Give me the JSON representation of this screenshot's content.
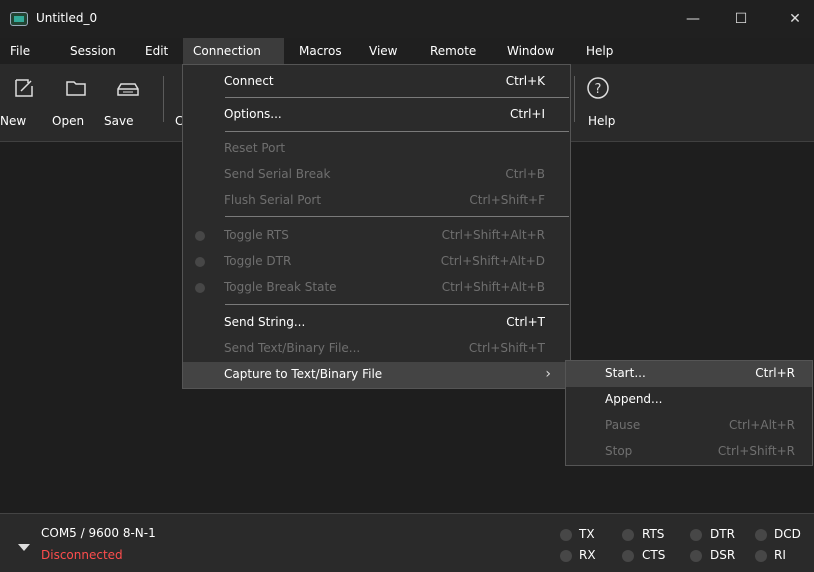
{
  "window": {
    "title": "Untitled_0",
    "minimize_glyph": "—",
    "maximize_glyph": "☐",
    "close_glyph": "✕"
  },
  "menubar": [
    {
      "label": "File",
      "active": false
    },
    {
      "label": "Session",
      "active": false
    },
    {
      "label": "Edit",
      "active": false
    },
    {
      "label": "Connection",
      "active": true
    },
    {
      "label": "Macros",
      "active": false
    },
    {
      "label": "View",
      "active": false
    },
    {
      "label": "Remote",
      "active": false
    },
    {
      "label": "Window",
      "active": false
    },
    {
      "label": "Help",
      "active": false
    }
  ],
  "toolbar": {
    "new": "New",
    "open": "Open",
    "save": "Save",
    "partial": "C",
    "help": "Help",
    "help_glyph": "?"
  },
  "connection_menu": [
    {
      "label": "Connect",
      "shortcut": "Ctrl+K",
      "disabled": false
    },
    {
      "label": "Options...",
      "shortcut": "Ctrl+I",
      "disabled": false
    },
    {
      "label": "Reset Port",
      "shortcut": "",
      "disabled": true
    },
    {
      "label": "Send Serial Break",
      "shortcut": "Ctrl+B",
      "disabled": true
    },
    {
      "label": "Flush Serial Port",
      "shortcut": "Ctrl+Shift+F",
      "disabled": true
    },
    {
      "label": "Toggle RTS",
      "shortcut": "Ctrl+Shift+Alt+R",
      "disabled": true
    },
    {
      "label": "Toggle DTR",
      "shortcut": "Ctrl+Shift+Alt+D",
      "disabled": true
    },
    {
      "label": "Toggle Break State",
      "shortcut": "Ctrl+Shift+Alt+B",
      "disabled": true
    },
    {
      "label": "Send String...",
      "shortcut": "Ctrl+T",
      "disabled": false
    },
    {
      "label": "Send Text/Binary File...",
      "shortcut": "Ctrl+Shift+T",
      "disabled": true
    },
    {
      "label": "Capture to Text/Binary File",
      "shortcut": "",
      "disabled": false,
      "active": true,
      "submenu_glyph": "›"
    }
  ],
  "capture_submenu": [
    {
      "label": "Start...",
      "shortcut": "Ctrl+R",
      "disabled": false,
      "active": true
    },
    {
      "label": "Append...",
      "shortcut": "",
      "disabled": false
    },
    {
      "label": "Pause",
      "shortcut": "Ctrl+Alt+R",
      "disabled": true
    },
    {
      "label": "Stop",
      "shortcut": "Ctrl+Shift+R",
      "disabled": true
    }
  ],
  "status": {
    "port": "COM5 / 9600 8-N-1",
    "connection": "Disconnected",
    "indicators": [
      "TX",
      "RTS",
      "DTR",
      "DCD",
      "RX",
      "CTS",
      "DSR",
      "RI"
    ]
  },
  "colors": {
    "background": "#1e1e1e",
    "menu_active": "#3c3c3c",
    "disconnected": "#ff4d4d"
  }
}
